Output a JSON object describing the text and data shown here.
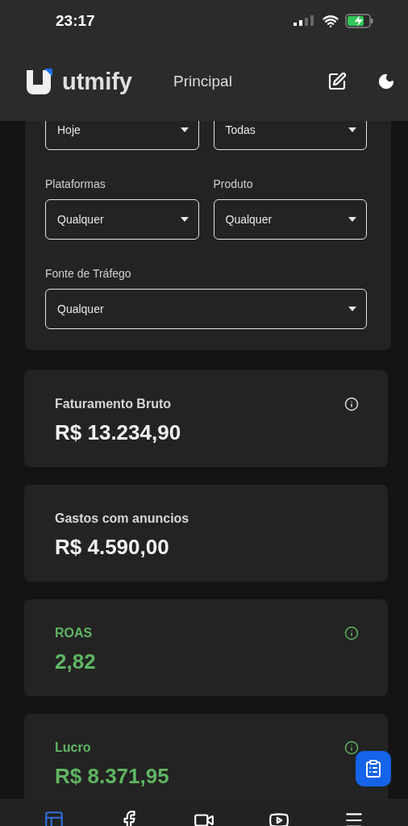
{
  "status_bar": {
    "time": "23:17"
  },
  "header": {
    "brand": "utmify",
    "title": "Principal"
  },
  "filters": [
    {
      "value": "Hoje"
    },
    {
      "value": "Todas"
    },
    {
      "label": "Plataformas",
      "value": "Qualquer"
    },
    {
      "label": "Produto",
      "value": "Qualquer"
    },
    {
      "label": "Fonte de Tráfego",
      "value": "Qualquer",
      "wide": true
    }
  ],
  "metrics": [
    {
      "title": "Faturamento Bruto",
      "value": "R$ 13.234,90",
      "kind": "neutral",
      "info": true
    },
    {
      "title": "Gastos com anuncios",
      "value": "R$ 4.590,00",
      "kind": "neutral",
      "info": false
    },
    {
      "title": "ROAS",
      "value": "2,82",
      "kind": "positive",
      "info": true
    },
    {
      "title": "Lucro",
      "value": "R$ 8.371,95",
      "kind": "positive",
      "info": true
    }
  ],
  "bottom_nav": [
    {
      "kind": "dashboard",
      "selected": true
    },
    {
      "kind": "facebook",
      "selected": false
    },
    {
      "kind": "video",
      "selected": false
    },
    {
      "kind": "youtube",
      "selected": false
    },
    {
      "kind": "menu",
      "selected": false
    }
  ]
}
